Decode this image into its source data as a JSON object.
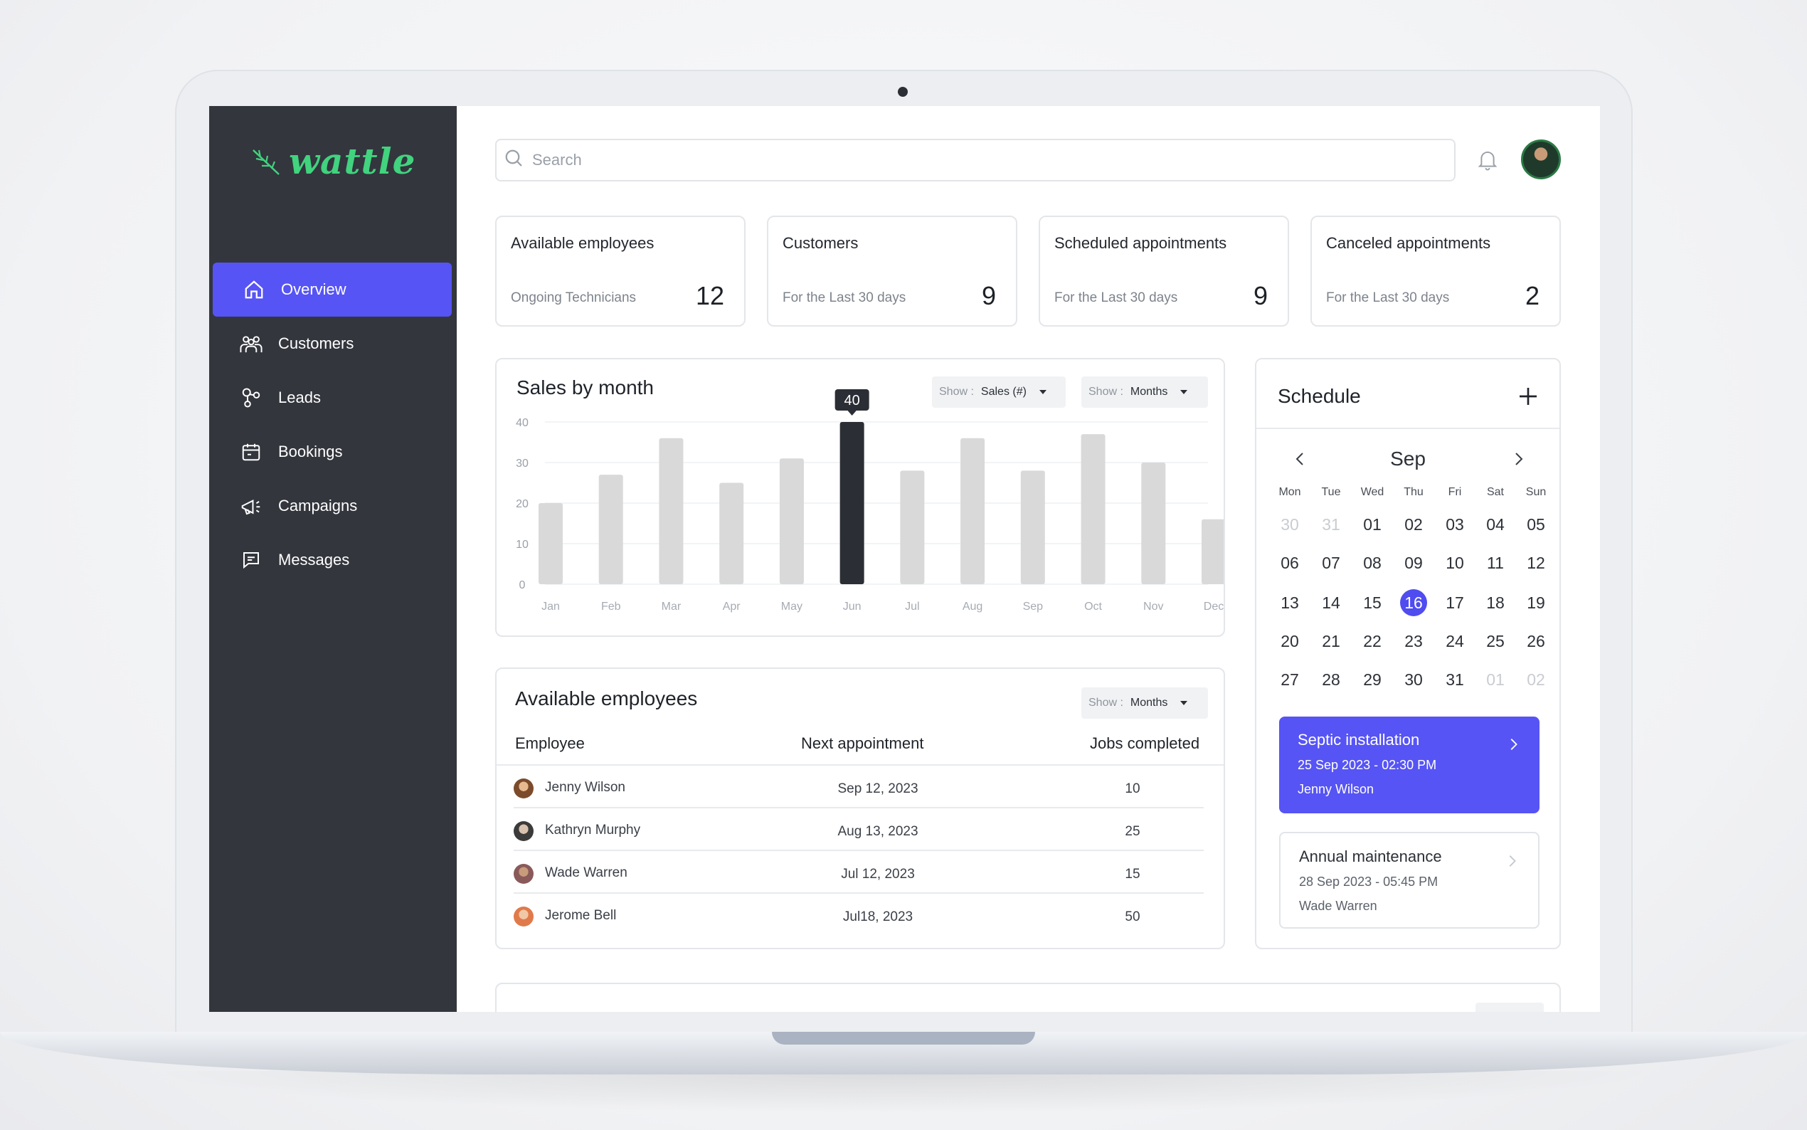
{
  "brand": {
    "name": "wattle",
    "color": "#41d37e",
    "accent": "#5654f4"
  },
  "sidebar": {
    "items": [
      {
        "label": "Overview",
        "icon": "home-icon",
        "active": true
      },
      {
        "label": "Customers",
        "icon": "users-icon"
      },
      {
        "label": "Leads",
        "icon": "leads-icon"
      },
      {
        "label": "Bookings",
        "icon": "calendar-icon"
      },
      {
        "label": "Campaigns",
        "icon": "megaphone-icon"
      },
      {
        "label": "Messages",
        "icon": "message-icon"
      }
    ]
  },
  "header": {
    "search_placeholder": "Search",
    "icons": [
      "search-icon",
      "bell-icon",
      "avatar"
    ]
  },
  "stats": [
    {
      "title": "Available employees",
      "subtitle": "Ongoing Technicians",
      "value": "12"
    },
    {
      "title": "Customers",
      "subtitle": "For the Last 30 days",
      "value": "9"
    },
    {
      "title": "Scheduled appointments",
      "subtitle": "For the Last 30 days",
      "value": "9"
    },
    {
      "title": "Canceled appointments",
      "subtitle": "For the Last 30 days",
      "value": "2"
    }
  ],
  "sales": {
    "title": "Sales by month",
    "filter1": {
      "label": "Show :",
      "value": "Sales (#)"
    },
    "filter2": {
      "label": "Show :",
      "value": "Months"
    },
    "tooltip": "40"
  },
  "chart_data": {
    "type": "bar",
    "title": "Sales by month",
    "categories": [
      "Jan",
      "Feb",
      "Mar",
      "Apr",
      "May",
      "Jun",
      "Jul",
      "Aug",
      "Sep",
      "Oct",
      "Nov",
      "Dec"
    ],
    "values": [
      20,
      27,
      36,
      25,
      31,
      40,
      28,
      36,
      28,
      37,
      30,
      16
    ],
    "highlight": "Jun",
    "yticks": [
      "40",
      "30",
      "20",
      "10",
      "0"
    ],
    "ylim": [
      0,
      40
    ],
    "grid": true,
    "colors": {
      "bar": "#d9d9d9",
      "highlight": "#2b2e34"
    }
  },
  "employees": {
    "title": "Available employees",
    "filter": {
      "label": "Show :",
      "value": "Months"
    },
    "columns": [
      "Employee",
      "Next appointment",
      "Jobs completed"
    ],
    "rows": [
      {
        "name": "Jenny Wilson",
        "next": "Sep 12, 2023",
        "jobs": "10"
      },
      {
        "name": "Kathryn Murphy",
        "next": "Aug 13, 2023",
        "jobs": "25"
      },
      {
        "name": "Wade Warren",
        "next": "Jul 12, 2023",
        "jobs": "15"
      },
      {
        "name": "Jerome Bell",
        "next": "Jul18, 2023",
        "jobs": "50"
      }
    ]
  },
  "schedule": {
    "title": "Schedule",
    "month": "Sep",
    "weekdays": [
      "Mon",
      "Tue",
      "Wed",
      "Thu",
      "Fri",
      "Sat",
      "Sun"
    ],
    "weeks": [
      [
        "30",
        "31",
        "01",
        "02",
        "03",
        "04",
        "05"
      ],
      [
        "06",
        "07",
        "08",
        "09",
        "10",
        "11",
        "12"
      ],
      [
        "13",
        "14",
        "15",
        "16",
        "17",
        "18",
        "19"
      ],
      [
        "20",
        "21",
        "22",
        "23",
        "24",
        "25",
        "26"
      ],
      [
        "27",
        "28",
        "29",
        "30",
        "31",
        "01",
        "02"
      ]
    ],
    "selected": "16",
    "appointments": [
      {
        "title": "Septic installation",
        "when": "25 Sep 2023 - 02:30 PM",
        "who": "Jenny Wilson",
        "active": true
      },
      {
        "title": "Annual maintenance",
        "when": "28 Sep 2023 - 05:45 PM",
        "who": "Wade Warren",
        "active": false
      }
    ]
  }
}
